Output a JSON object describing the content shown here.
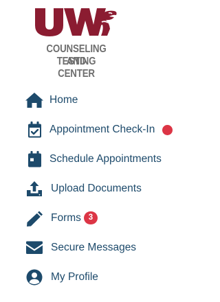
{
  "logo": {
    "mark": "UW",
    "line1": "COUNSELING AND",
    "line2": "TESTING CENTER",
    "brand_color": "#8b1c31",
    "text_color": "#6e6e6e"
  },
  "nav": {
    "items": [
      {
        "label": "Home",
        "icon": "home-icon"
      },
      {
        "label": "Appointment Check-In",
        "icon": "calendar-check-icon",
        "indicator": "dot"
      },
      {
        "label": "Schedule Appointments",
        "icon": "calendar-icon"
      },
      {
        "label": "Upload Documents",
        "icon": "upload-icon"
      },
      {
        "label": "Forms",
        "icon": "pencil-icon",
        "badge": "3"
      },
      {
        "label": "Secure Messages",
        "icon": "envelope-icon"
      },
      {
        "label": "My Profile",
        "icon": "user-circle-icon"
      }
    ],
    "icon_color": "#1d4a6b",
    "text_color": "#1d4a6b",
    "alert_color": "#dc3545"
  }
}
